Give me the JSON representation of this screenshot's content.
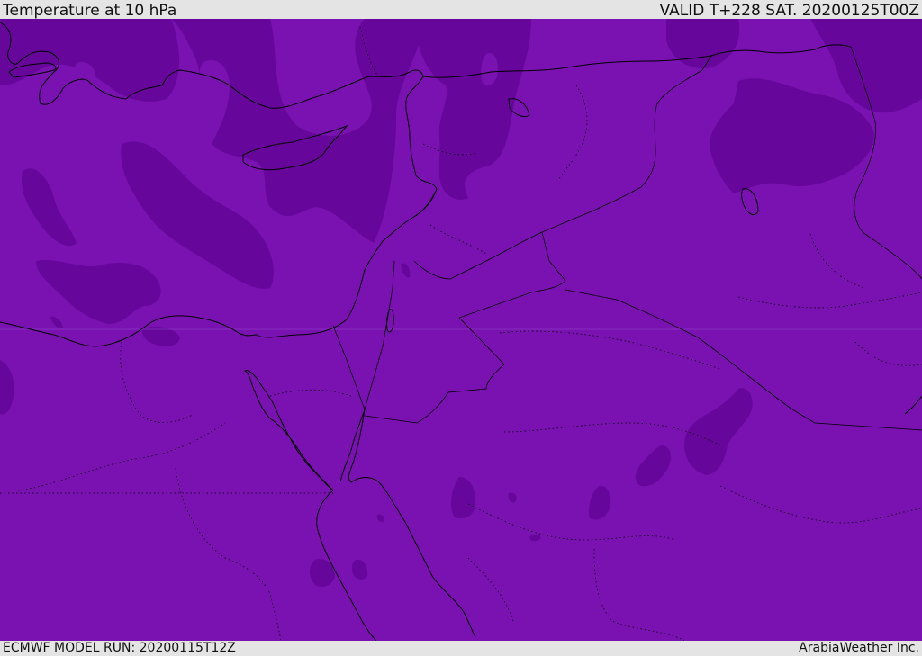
{
  "header": {
    "title": "Temperature at 10 hPa",
    "valid_time": "VALID T+228 SAT. 20200125T00Z"
  },
  "footer": {
    "model_run": "ECMWF MODEL RUN: 20200115T12Z",
    "credit": "ArabiaWeather Inc."
  },
  "map": {
    "field": "Temperature",
    "level": "10 hPa",
    "colors": {
      "base_fill": "#7a12b2",
      "cold_fill": "#66069b",
      "coastline": "#000000",
      "border": "#000000",
      "grid_line": "#8a3ac0"
    }
  }
}
